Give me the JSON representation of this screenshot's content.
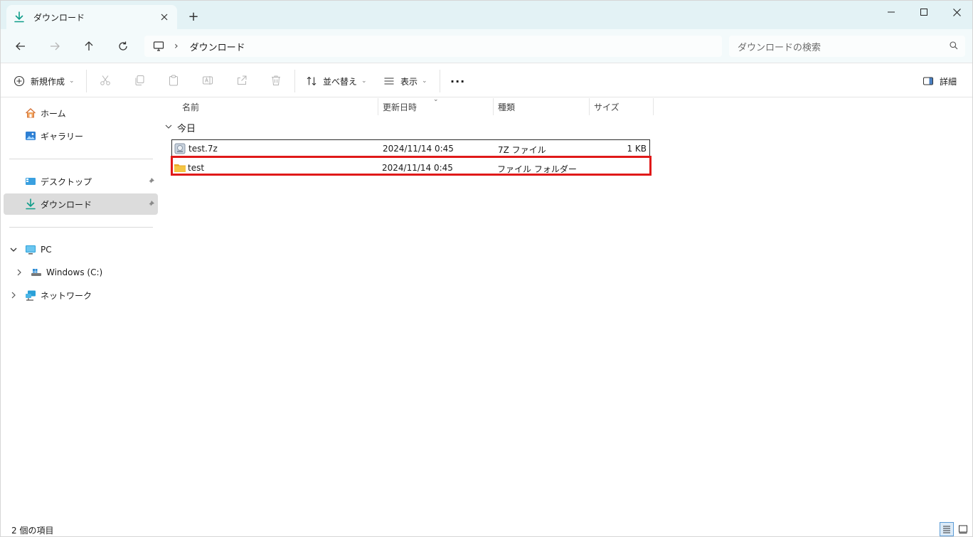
{
  "window": {
    "tab_title": "ダウンロード",
    "new_tab": "+"
  },
  "nav": {
    "breadcrumb_sep": "›",
    "breadcrumb": "ダウンロード",
    "search_placeholder": "ダウンロードの検索"
  },
  "toolbar": {
    "new_label": "新規作成",
    "sort_label": "並べ替え",
    "view_label": "表示",
    "more_label": "···",
    "details_label": "詳細"
  },
  "sidebar": {
    "home": "ホーム",
    "gallery": "ギャラリー",
    "desktop": "デスクトップ",
    "downloads": "ダウンロード",
    "pc": "PC",
    "windows_c": "Windows (C:)",
    "network": "ネットワーク"
  },
  "columns": {
    "name": "名前",
    "modified": "更新日時",
    "type": "種類",
    "size": "サイズ"
  },
  "group": {
    "label": "今日"
  },
  "files": [
    {
      "name": "test.7z",
      "modified": "2024/11/14 0:45",
      "type": "7Z ファイル",
      "size": "1 KB",
      "icon": "archive-file-icon"
    },
    {
      "name": "test",
      "modified": "2024/11/14 0:45",
      "type": "ファイル フォルダー",
      "size": "",
      "icon": "folder-icon"
    }
  ],
  "status": {
    "item_count": "2 個の項目"
  },
  "colors": {
    "accent": "#0f9d8a",
    "title_bg": "#e3f2f5",
    "selected_bg": "#dcdcdc",
    "highlight": "#e01919",
    "folder": "#f4c542"
  }
}
